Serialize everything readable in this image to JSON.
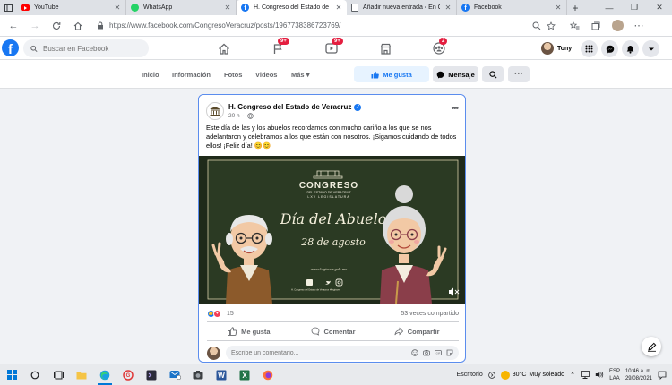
{
  "browser": {
    "tabs": [
      {
        "title": "YouTube",
        "icon": "youtube-icon",
        "active": false
      },
      {
        "title": "WhatsApp",
        "icon": "whatsapp-icon",
        "active": false
      },
      {
        "title": "H. Congreso del Estado de Vera",
        "icon": "facebook-icon",
        "active": true
      },
      {
        "title": "Añadir nueva entrada ‹ En Co",
        "icon": "document-icon",
        "active": false
      },
      {
        "title": "Facebook",
        "icon": "facebook-icon",
        "active": false
      }
    ],
    "url": "https://www.facebook.com/CongresoVeracruz/posts/1967738386723769/"
  },
  "fbnav": {
    "logo": "f",
    "search_placeholder": "Buscar en Facebook",
    "flag_badge": "9+",
    "watch_badge": "9+",
    "groups_badge": "2",
    "profile_name": "Tony"
  },
  "page_nav": {
    "links": [
      "Inicio",
      "Información",
      "Fotos",
      "Videos",
      "Más"
    ],
    "like_button": "Me gusta",
    "message_button": "Mensaje"
  },
  "post": {
    "author": "H. Congreso del Estado de Veracruz",
    "time": "20 h",
    "text": "Este día de las y los abuelos recordamos con mucho cariño a los que se nos adelantaron y celebramos a los que están con nosotros. ¡Sigamos cuidando de todos ellos! ¡Feliz día! 😊😊",
    "image": {
      "logo_title": "CONGRESO",
      "logo_sub1": "DEL ESTADO DE VERACRUZ",
      "logo_sub2": "LXV LEGISLATURA",
      "headline": "Día del Abuelo",
      "date": "28 de agosto",
      "website": "www.legisver.gob.mx",
      "footer_left": "H. Congreso del Estado de Veracruz",
      "footer_right": "#legisver"
    },
    "reaction_count": "15",
    "shares": "53 veces compartido",
    "actions": {
      "like": "Me gusta",
      "comment": "Comentar",
      "share": "Compartir"
    },
    "comment_placeholder": "Escribe un comentario..."
  },
  "taskbar": {
    "desktop_label": "Escritorio",
    "temperature": "30°C",
    "weather": "Muy soleado",
    "lang_top": "ESP",
    "lang_bottom": "LAA",
    "time": "10:46 a. m.",
    "date": "29/08/2021"
  },
  "colors": {
    "facebook_blue": "#1877f2",
    "badge_red": "#e41e3f",
    "image_bg": "#1f2a1a"
  }
}
